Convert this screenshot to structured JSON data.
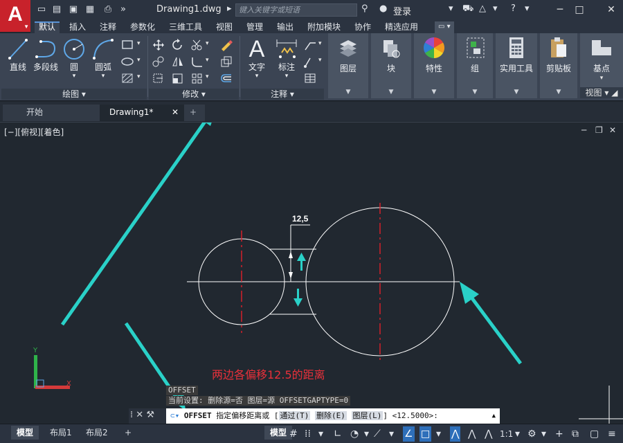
{
  "titlebar": {
    "app_logo": "A",
    "doc_title": "Drawing1.dwg",
    "search_placeholder": "键入关键字或短语",
    "login": "登录"
  },
  "ribbon_tabs": [
    "默认",
    "插入",
    "注释",
    "参数化",
    "三维工具",
    "视图",
    "管理",
    "输出",
    "附加模块",
    "协作",
    "精选应用"
  ],
  "ribbon": {
    "draw": {
      "title": "绘图",
      "line": "直线",
      "polyline": "多段线",
      "circle": "圆",
      "arc": "圆弧"
    },
    "modify": {
      "title": "修改"
    },
    "annotation": {
      "title": "注释",
      "text": "文字",
      "dimension": "标注"
    },
    "layers": "图层",
    "block": "块",
    "properties": "特性",
    "groups": "组",
    "utilities": "实用工具",
    "clipboard": "剪贴板",
    "view": {
      "base": "基点",
      "title": "视图"
    }
  },
  "doc_tabs": {
    "start": "开始",
    "drawing": "Drawing1*"
  },
  "viewport": {
    "label": "[−][俯视][着色]"
  },
  "drawing": {
    "dimension_text": "12,5",
    "annotation": "两边各偏移12.5的距离",
    "colors": {
      "geometry": "#ffffff",
      "centerline": "#e0202a",
      "arrow": "#2ad1c8",
      "annotation": "#e8303a"
    }
  },
  "command": {
    "history": [
      "OFFSET",
      "当前设置: 删除源=否  图层=源  OFFSETGAPTYPE=0"
    ],
    "name": "OFFSET",
    "prompt": "指定偏移距离或",
    "options": [
      "通过(T)",
      "删除(E)",
      "图层(L)"
    ],
    "default_value": "<12.5000>:"
  },
  "statusbar": {
    "layouts": [
      "模型",
      "布局1",
      "布局2"
    ],
    "model_button": "模型",
    "scale": "1:1"
  }
}
